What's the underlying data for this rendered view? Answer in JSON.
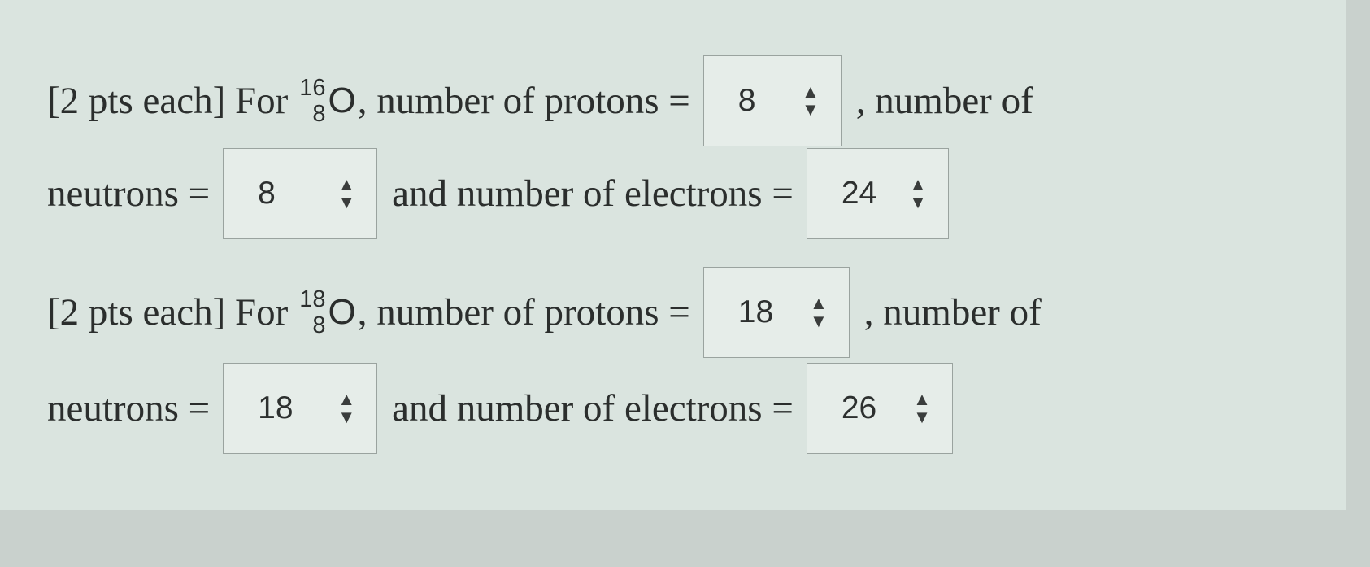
{
  "questions": [
    {
      "prefix": "[2 pts each] For",
      "isotope": {
        "mass_number": "16",
        "atomic_number": "8",
        "symbol": "O"
      },
      "protons_label": ", number of protons =",
      "protons_value": "8",
      "after_protons": ", number of",
      "neutrons_label": "neutrons =",
      "neutrons_value": "8",
      "electrons_label": "and number of electrons =",
      "electrons_value": "24"
    },
    {
      "prefix": "[2 pts each] For",
      "isotope": {
        "mass_number": "18",
        "atomic_number": "8",
        "symbol": "O"
      },
      "protons_label": ", number of protons =",
      "protons_value": "18",
      "after_protons": ", number of",
      "neutrons_label": "neutrons =",
      "neutrons_value": "18",
      "electrons_label": "and number of electrons =",
      "electrons_value": "26"
    }
  ],
  "spinner_icon": "up-down-arrows-icon"
}
